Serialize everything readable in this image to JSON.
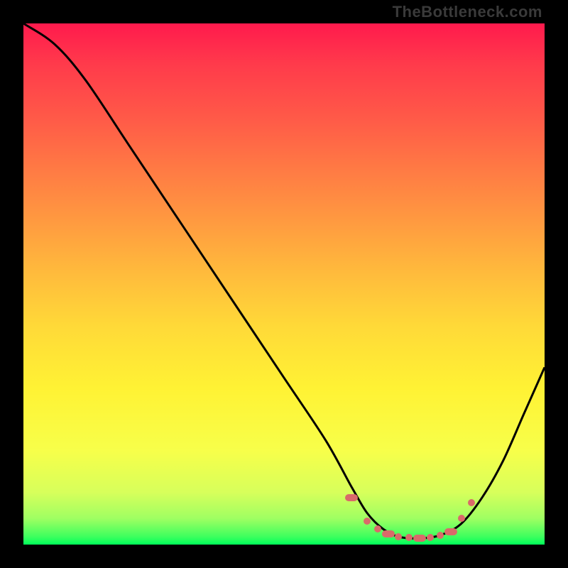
{
  "watermark": "TheBottleneck.com",
  "chart_data": {
    "type": "line",
    "title": "",
    "xlabel": "",
    "ylabel": "",
    "xlim": [
      0,
      100
    ],
    "ylim": [
      0,
      100
    ],
    "series": [
      {
        "name": "curve",
        "points": [
          {
            "x": 0,
            "y": 100
          },
          {
            "x": 6,
            "y": 96
          },
          {
            "x": 12,
            "y": 89
          },
          {
            "x": 20,
            "y": 77
          },
          {
            "x": 30,
            "y": 62
          },
          {
            "x": 40,
            "y": 47
          },
          {
            "x": 50,
            "y": 32
          },
          {
            "x": 58,
            "y": 20
          },
          {
            "x": 63,
            "y": 11
          },
          {
            "x": 66,
            "y": 6
          },
          {
            "x": 69,
            "y": 3
          },
          {
            "x": 72,
            "y": 1.5
          },
          {
            "x": 76,
            "y": 1.2
          },
          {
            "x": 80,
            "y": 1.8
          },
          {
            "x": 84,
            "y": 4
          },
          {
            "x": 88,
            "y": 9
          },
          {
            "x": 92,
            "y": 16
          },
          {
            "x": 96,
            "y": 25
          },
          {
            "x": 100,
            "y": 34
          }
        ]
      }
    ],
    "highlight_dots": [
      {
        "x": 63,
        "y": 9
      },
      {
        "x": 66,
        "y": 4.5
      },
      {
        "x": 68,
        "y": 3
      },
      {
        "x": 70,
        "y": 2
      },
      {
        "x": 72,
        "y": 1.5
      },
      {
        "x": 74,
        "y": 1.3
      },
      {
        "x": 76,
        "y": 1.2
      },
      {
        "x": 78,
        "y": 1.4
      },
      {
        "x": 80,
        "y": 1.8
      },
      {
        "x": 82,
        "y": 2.5
      },
      {
        "x": 84,
        "y": 5
      },
      {
        "x": 86,
        "y": 8
      }
    ]
  }
}
